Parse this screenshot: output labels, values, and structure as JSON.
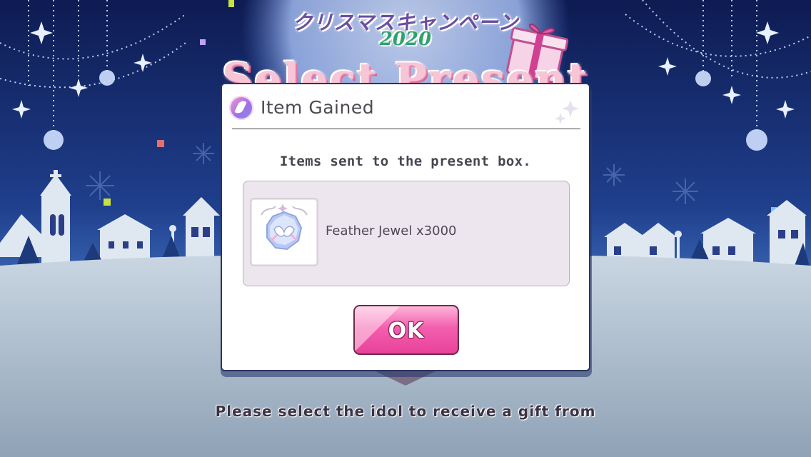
{
  "background": {
    "campaign_title_jp": "クリスマスキャンペーン",
    "campaign_year": "2020",
    "banner_title": "Select Present",
    "prompt": "Please select the idol to receive a gift from"
  },
  "dialog": {
    "title": "Item Gained",
    "icon": "feather-jewel-icon",
    "message": "Items sent to the present box.",
    "items": [
      {
        "name": "Feather Jewel x3000",
        "icon": "feather-jewel-icon"
      }
    ],
    "ok_label": "OK"
  },
  "colors": {
    "sky_dark": "#0f1d55",
    "sky_light": "#2a4fa0",
    "snow": "#aebfcf",
    "dialog_border": "#2a3560",
    "panel_bg": "#eee6ee",
    "ok_button_pink": "#f35fae"
  }
}
